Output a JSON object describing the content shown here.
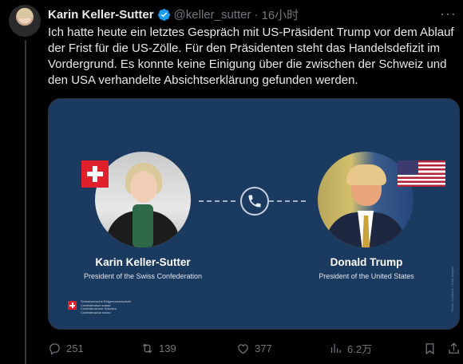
{
  "tweet": {
    "author_name": "Karin Keller-Sutter",
    "handle": "@keller_sutter",
    "separator": "·",
    "time": "16小时",
    "more": "···",
    "text": "Ich hatte heute ein letztes Gespräch mit US-Präsident Trump vor dem Ablauf der Frist für die US-Zölle. Für den Präsidenten steht das Handelsdefizit im Vordergrund. Es konnte keine Einigung über die zwischen der Schweiz und den USA verhandelte Absichtserklärung gefunden werden."
  },
  "card": {
    "left_name": "Karin Keller-Sutter",
    "left_role": "President of the Swiss Confederation",
    "right_name": "Donald Trump",
    "right_role": "President of the United States",
    "logo_lines": [
      "Schweizerische Eidgenossenschaft",
      "Confédération suisse",
      "Confederazione Svizzera",
      "Confederaziun svizra"
    ],
    "watermark": "Photo: Keystone / Getty Images",
    "bg_color": "#1b3a60"
  },
  "actions": {
    "replies": "251",
    "retweets": "139",
    "likes": "377",
    "views": "6.2万"
  },
  "colors": {
    "background": "#000000",
    "text": "#e7e9ea",
    "muted": "#71767b",
    "verified": "#1d9bf0"
  }
}
